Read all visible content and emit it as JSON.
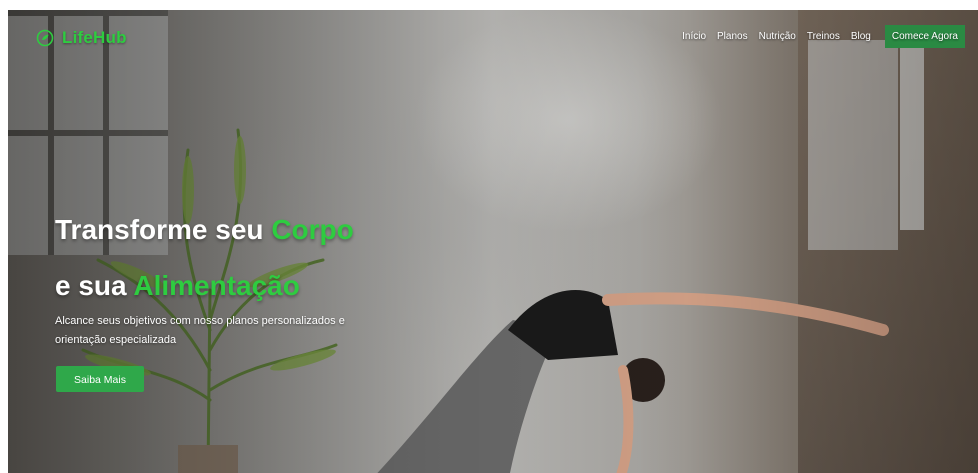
{
  "brand": {
    "name": "LifeHub",
    "icon": "leaf-circle-icon"
  },
  "nav": {
    "items": [
      "Início",
      "Planos",
      "Nutrição",
      "Treinos",
      "Blog"
    ],
    "cta": "Comece Agora"
  },
  "hero": {
    "title_line1": "Transforme seu ",
    "title_line1_accent": "Corpo",
    "title_line2": "e sua ",
    "title_line2_accent": "Alimentação",
    "subtitle": "Alcance seus objetivos com nosso planos personalizados e orientação especializada",
    "button": "Saiba Mais"
  },
  "colors": {
    "accent": "#2ecc40",
    "cta": "#2a8a43",
    "button": "#2fa84a"
  }
}
